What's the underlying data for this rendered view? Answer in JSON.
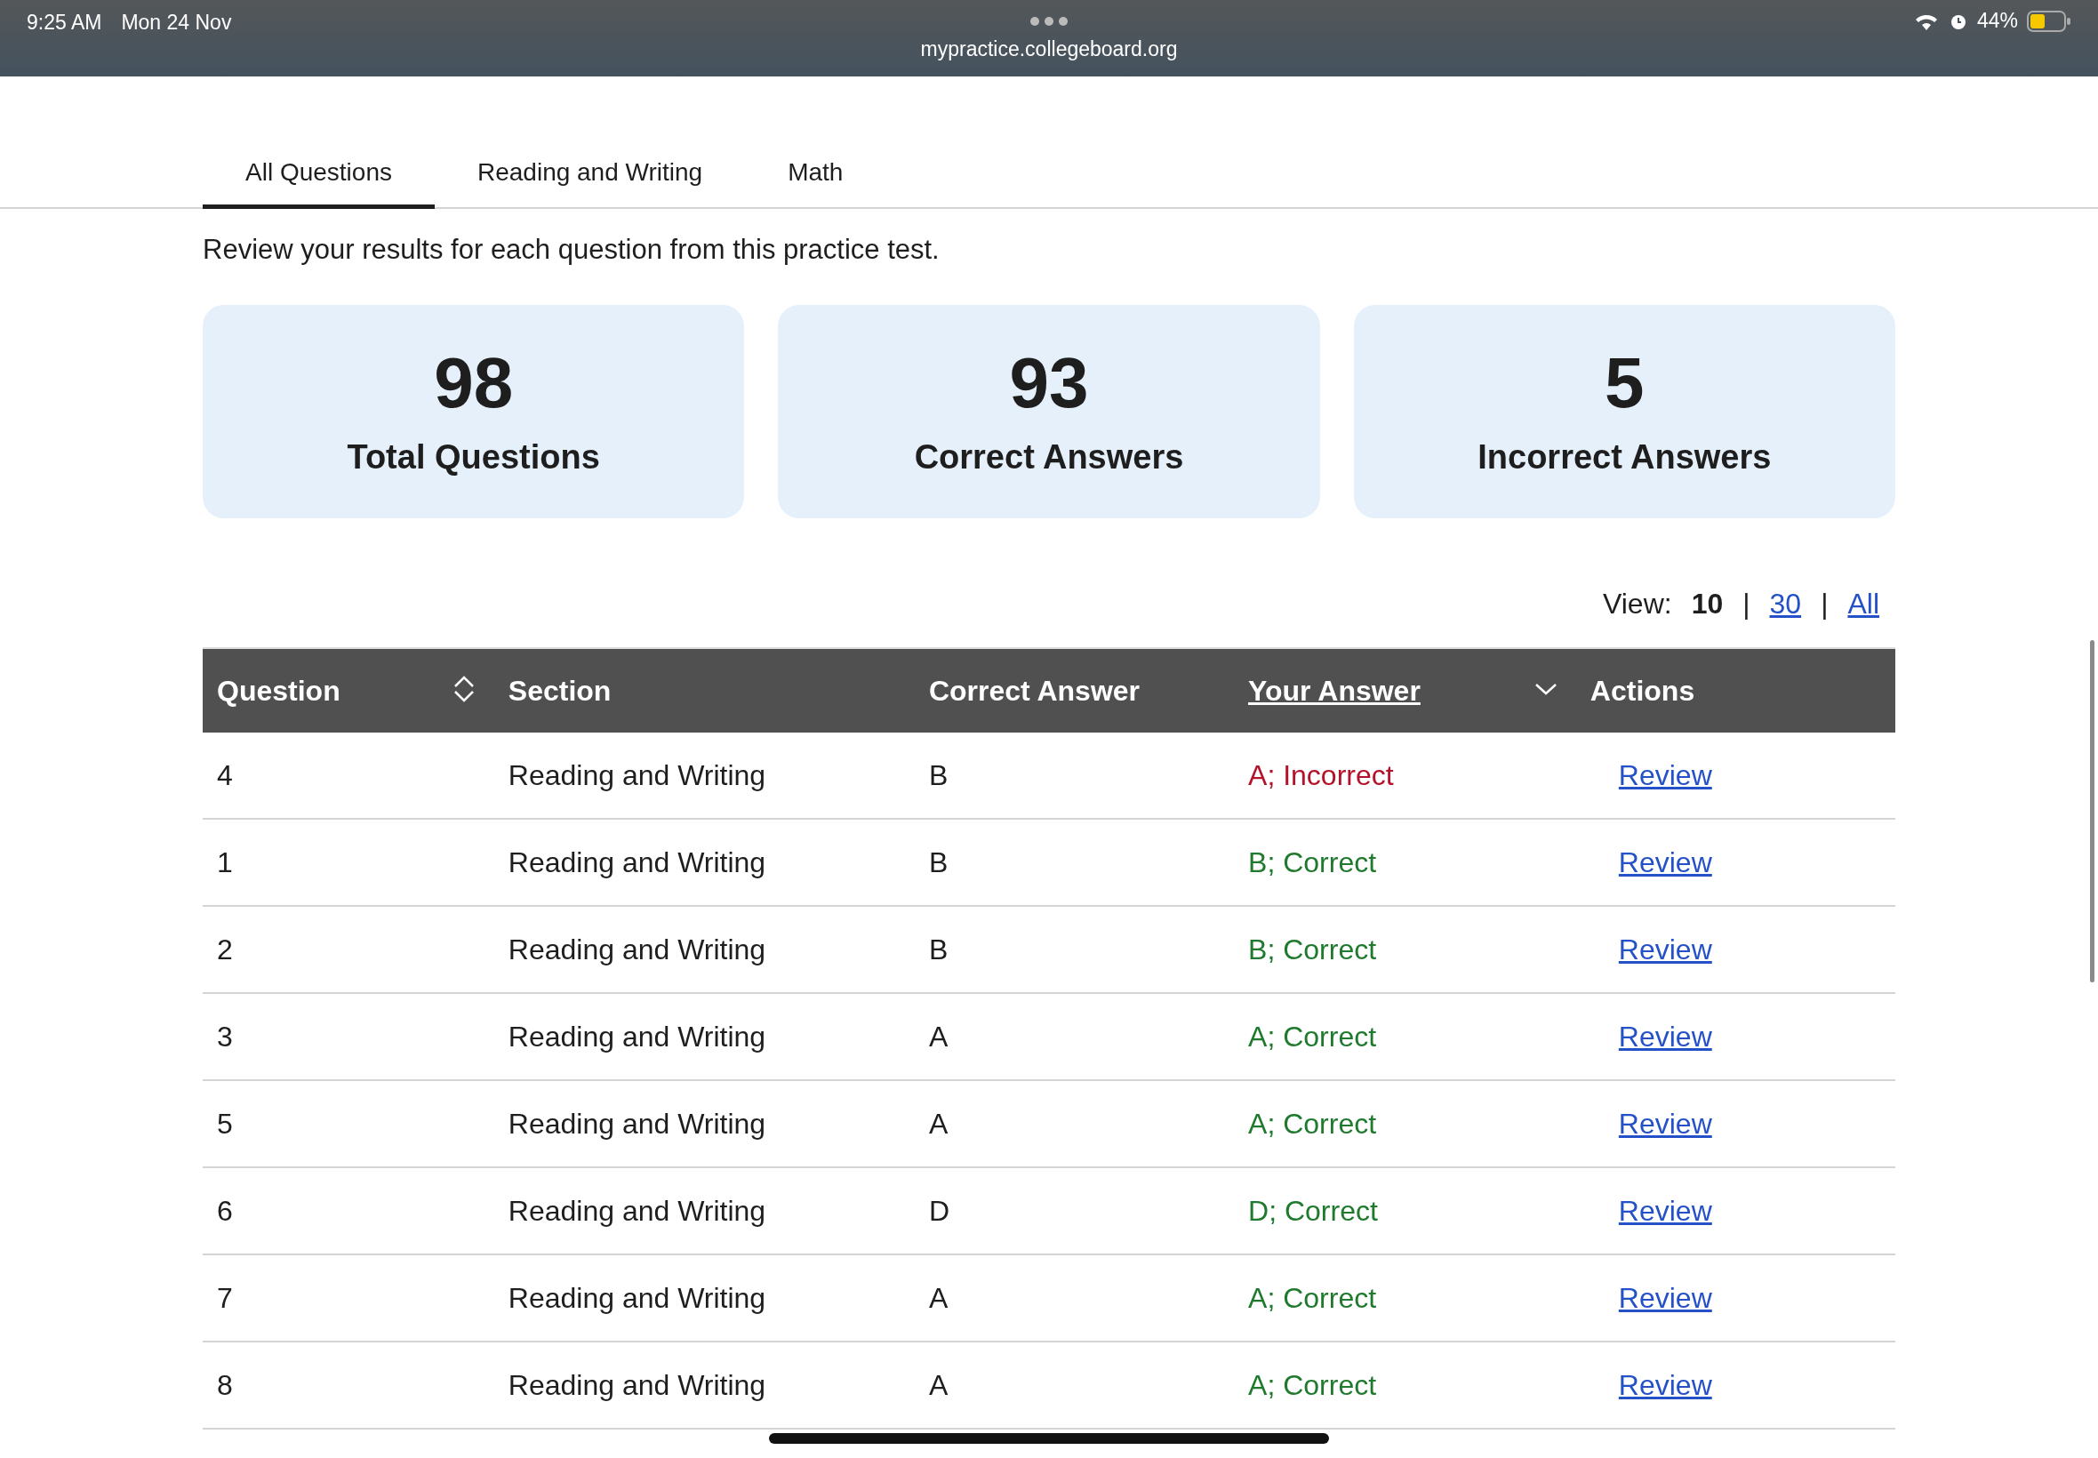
{
  "status_bar": {
    "time": "9:25 AM",
    "date": "Mon 24 Nov",
    "battery": "44%",
    "url": "mypractice.collegeboard.org"
  },
  "tabs": [
    {
      "label": "All Questions",
      "selected": true
    },
    {
      "label": "Reading and Writing",
      "selected": false
    },
    {
      "label": "Math",
      "selected": false
    }
  ],
  "description": "Review your results for each question from this practice test.",
  "stats": [
    {
      "value": "98",
      "label": "Total Questions"
    },
    {
      "value": "93",
      "label": "Correct Answers"
    },
    {
      "value": "5",
      "label": "Incorrect Answers"
    }
  ],
  "view": {
    "label": "View:",
    "separator": "|",
    "options": [
      {
        "label": "10",
        "selected": true
      },
      {
        "label": "30",
        "selected": false
      },
      {
        "label": "All",
        "selected": false
      }
    ]
  },
  "table": {
    "columns": [
      {
        "label": "Question",
        "kind": "sortable",
        "active": false
      },
      {
        "label": "Section",
        "kind": "plain"
      },
      {
        "label": "Correct Answer",
        "kind": "plain"
      },
      {
        "label": "Your Answer",
        "kind": "sorted",
        "active": true
      },
      {
        "label": "Actions",
        "kind": "plain"
      }
    ],
    "rows": [
      {
        "question": "4",
        "section": "Reading and Writing",
        "correct_answer": "B",
        "your_answer": "A; Incorrect",
        "correct": false,
        "action": "Review"
      },
      {
        "question": "1",
        "section": "Reading and Writing",
        "correct_answer": "B",
        "your_answer": "B; Correct",
        "correct": true,
        "action": "Review"
      },
      {
        "question": "2",
        "section": "Reading and Writing",
        "correct_answer": "B",
        "your_answer": "B; Correct",
        "correct": true,
        "action": "Review"
      },
      {
        "question": "3",
        "section": "Reading and Writing",
        "correct_answer": "A",
        "your_answer": "A; Correct",
        "correct": true,
        "action": "Review"
      },
      {
        "question": "5",
        "section": "Reading and Writing",
        "correct_answer": "A",
        "your_answer": "A; Correct",
        "correct": true,
        "action": "Review"
      },
      {
        "question": "6",
        "section": "Reading and Writing",
        "correct_answer": "D",
        "your_answer": "D; Correct",
        "correct": true,
        "action": "Review"
      },
      {
        "question": "7",
        "section": "Reading and Writing",
        "correct_answer": "A",
        "your_answer": "A; Correct",
        "correct": true,
        "action": "Review"
      },
      {
        "question": "8",
        "section": "Reading and Writing",
        "correct_answer": "A",
        "your_answer": "A; Correct",
        "correct": true,
        "action": "Review"
      }
    ]
  }
}
